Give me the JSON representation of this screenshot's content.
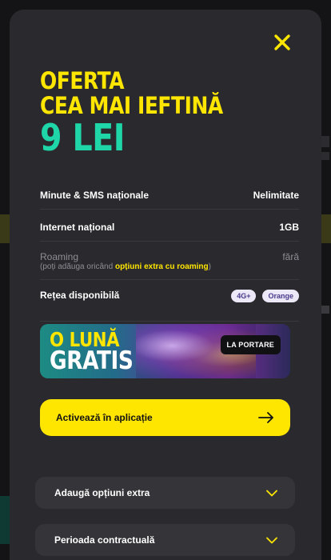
{
  "offer": {
    "title_line1": "OFERTA",
    "title_line2": "CEA MAI IEFTINĂ",
    "price": "9 LEI"
  },
  "features": [
    {
      "label": "Minute & SMS naționale",
      "value": "Nelimitate"
    },
    {
      "label": "Internet național",
      "value": "1GB"
    },
    {
      "label": "Roaming",
      "value": "fără",
      "note_prefix": "(poți adăuga oricând ",
      "note_link": "opțiuni extra cu roaming",
      "note_suffix": ")"
    },
    {
      "label": "Rețea disponibilă",
      "badges": [
        "4G+",
        "Orange"
      ]
    }
  ],
  "banner": {
    "line1": "O LUNĂ",
    "line2": "GRATIS",
    "pill": "LA PORTARE"
  },
  "cta": {
    "label": "Activează în aplicație"
  },
  "accordions": [
    {
      "label": "Adaugă opțiuni extra"
    },
    {
      "label": "Perioada contractuală"
    }
  ],
  "colors": {
    "accent_yellow": "#ffe600",
    "accent_green": "#1ed6a8",
    "modal_bg": "#2a2a2e"
  },
  "icons": {
    "close": "close-icon",
    "arrow": "arrow-right-icon",
    "chevron": "chevron-down-icon"
  }
}
